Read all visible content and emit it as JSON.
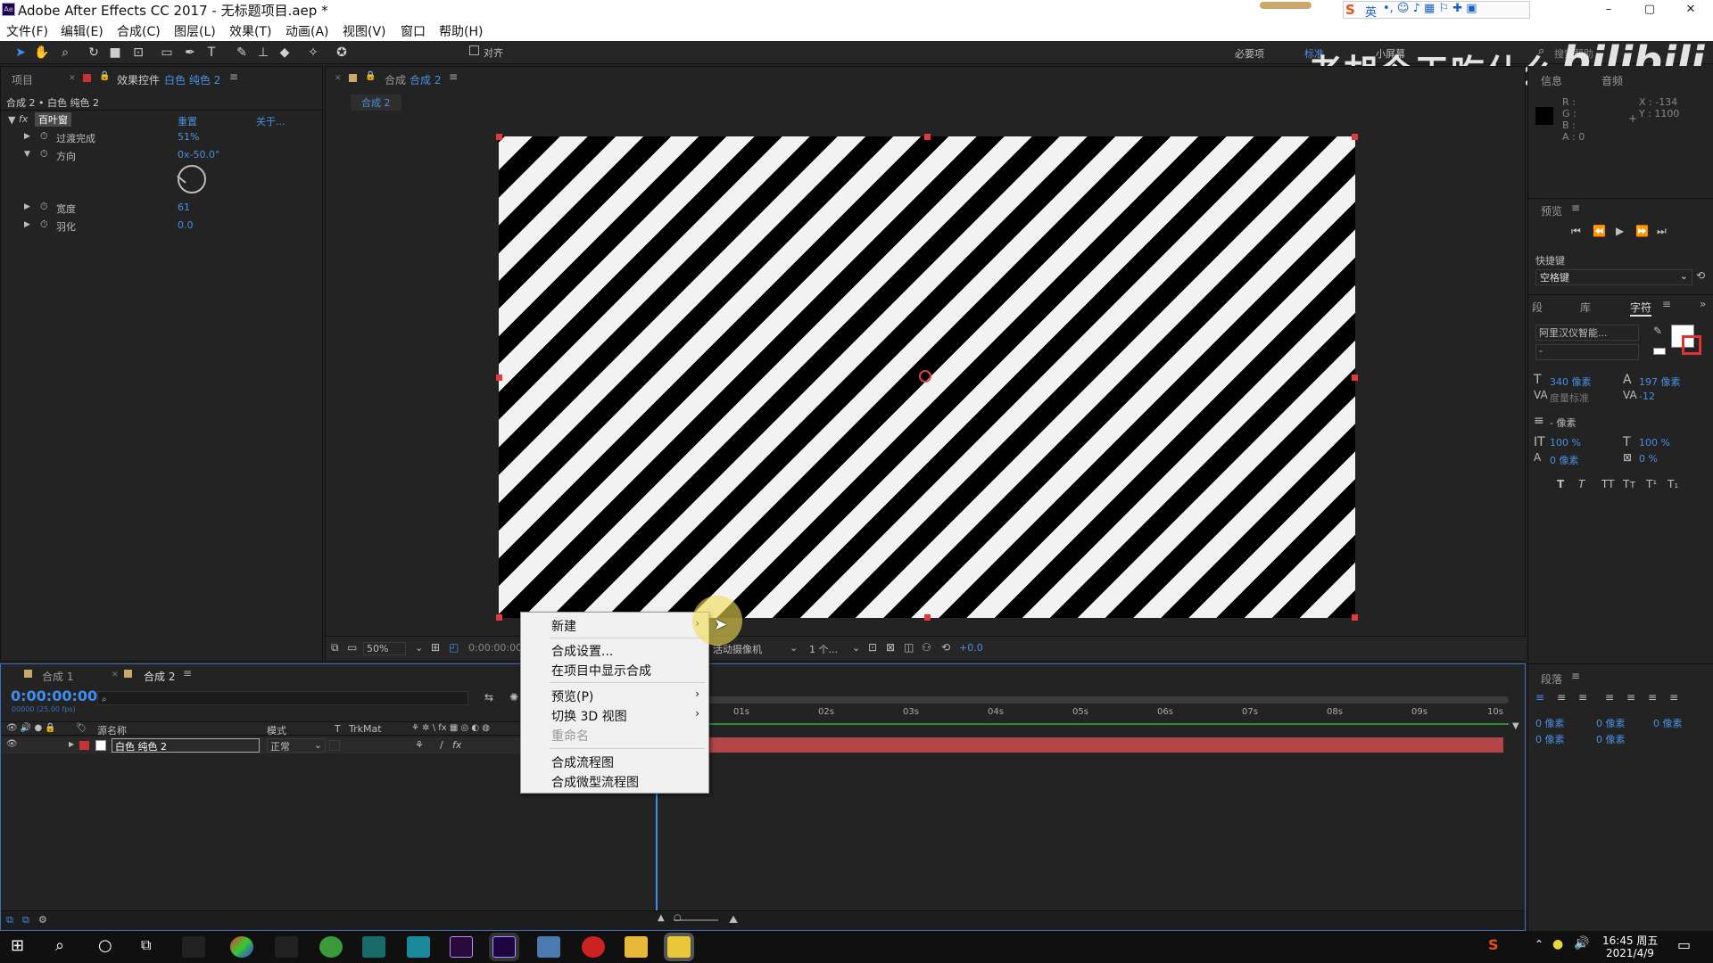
{
  "window": {
    "title": "Adobe After Effects CC 2017 - 无标题项目.aep *",
    "min": "–",
    "max": "▢",
    "close": "✕"
  },
  "menu": [
    "文件(F)",
    "编辑(E)",
    "合成(C)",
    "图层(L)",
    "效果(T)",
    "动画(A)",
    "视图(V)",
    "窗口",
    "帮助(H)"
  ],
  "toolbar": {
    "align_label": "对齐",
    "workspace": [
      "必要项",
      "标准",
      "小屏幕"
    ],
    "search_placeholder": "搜索帮助"
  },
  "ime": {
    "label": "英"
  },
  "watermark": {
    "text": "老胡今天吃什么",
    "logo": "bilibili"
  },
  "project_panel": {
    "tab_project": "项目",
    "tab_effects": "效果控件",
    "tab_effects_target": "白色 纯色 2",
    "breadcrumb": "合成 2 • 白色 纯色 2"
  },
  "effect": {
    "fx": "fx",
    "name": "百叶窗",
    "reset": "重置",
    "about": "关于...",
    "props": [
      {
        "name": "过渡完成",
        "value": "51%"
      },
      {
        "name": "方向",
        "value": "0x-50.0°"
      },
      {
        "name": "宽度",
        "value": "61"
      },
      {
        "name": "羽化",
        "value": "0.0"
      }
    ]
  },
  "comp_panel": {
    "tab": "合成",
    "tab_name": "合成 2",
    "sub_tab": "合成 2",
    "zoom": "50%",
    "timecode": "0:00:00:00",
    "camera": "活动摄像机",
    "views": "1 个...",
    "exposure": "+0.0"
  },
  "context_menu": {
    "items": [
      "新建",
      "合成设置...",
      "在项目中显示合成",
      "预览(P)",
      "切换 3D 视图",
      "重命名",
      "合成流程图",
      "合成微型流程图"
    ],
    "arrow": "›"
  },
  "timeline": {
    "tab1": "合成 1",
    "tab2": "合成 2",
    "timecode": "0:00:00:00",
    "fps": "00000 (25.00 fps)",
    "col_source": "源名称",
    "col_mode": "模式",
    "col_t": "T",
    "col_trkmat": "TrkMat",
    "layer_name": "白色 纯色 2",
    "layer_mode": "正常",
    "ruler": [
      "01s",
      "02s",
      "03s",
      "04s",
      "05s",
      "06s",
      "07s",
      "08s",
      "09s",
      "10s"
    ]
  },
  "info_panel": {
    "tab": "信息",
    "tab2": "音频",
    "r": "R :",
    "g": "G :",
    "b": "B :",
    "a": "A : 0",
    "x": "X : -134",
    "y": "Y : 1100"
  },
  "preview_panel": {
    "tab": "预览",
    "shortcut_label": "快捷键",
    "shortcut_value": "空格键"
  },
  "char_panel": {
    "tab1": "段",
    "tab2": "库",
    "tab3": "字符",
    "font": "阿里汉仪智能...",
    "style": "-",
    "size": "340 像素",
    "leading": "197 像素",
    "kerning": "度量标准",
    "tracking": "-12",
    "stroke": "- 像素",
    "vscale": "100 %",
    "hscale": "100 %",
    "baseline": "0 像素",
    "tsume": "0 %",
    "styles": [
      "T",
      "T",
      "TT",
      "Tт",
      "T¹",
      "T₁"
    ]
  },
  "para_panel": {
    "tab": "段落",
    "v1": "0 像素",
    "v2": "0 像素",
    "v3": "0 像素",
    "v4": "0 像素",
    "v5": "0 像素"
  },
  "clock": {
    "time": "16:45 周五",
    "date": "2021/4/9"
  }
}
